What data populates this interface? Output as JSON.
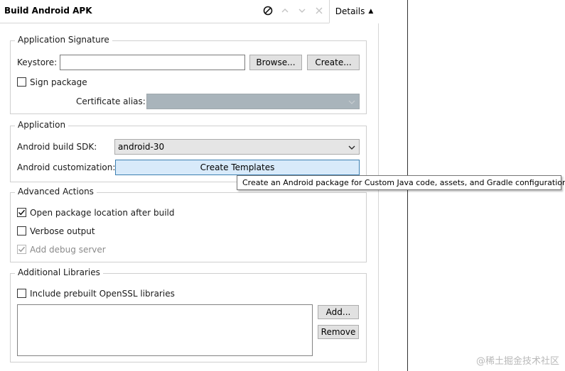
{
  "header": {
    "title": "Build Android APK",
    "details_label": "Details",
    "icons": [
      "cancel-icon",
      "chevron-up-icon",
      "chevron-down-icon",
      "close-icon",
      "caret-up-icon"
    ]
  },
  "signature": {
    "legend": "Application Signature",
    "keystore_label": "Keystore:",
    "keystore_value": "",
    "browse_label": "Browse...",
    "create_label": "Create...",
    "sign_package_label": "Sign package",
    "sign_package_checked": false,
    "cert_alias_label": "Certificate alias:",
    "cert_alias_value": ""
  },
  "application": {
    "legend": "Application",
    "sdk_label": "Android build SDK:",
    "sdk_value": "android-30",
    "custom_label": "Android customization:",
    "templates_label": "Create Templates"
  },
  "tooltip": {
    "text": "Create an Android package for Custom Java code, assets, and Gradle configurations."
  },
  "advanced": {
    "legend": "Advanced Actions",
    "open_location_label": "Open package location after build",
    "open_location_checked": true,
    "verbose_label": "Verbose output",
    "verbose_checked": false,
    "debug_label": "Add debug server",
    "debug_checked": true,
    "debug_disabled": true
  },
  "libraries": {
    "legend": "Additional Libraries",
    "openssl_label": "Include prebuilt OpenSSL libraries",
    "openssl_checked": false,
    "add_label": "Add...",
    "remove_label": "Remove",
    "items": []
  },
  "watermark": "@稀土掘金技术社区",
  "colors": {
    "tooltip_border": "#767676",
    "template_button_bg": "#d8eafa",
    "template_button_border": "#3c7fb1",
    "disabled_combo_bg": "#a9b4bb"
  }
}
